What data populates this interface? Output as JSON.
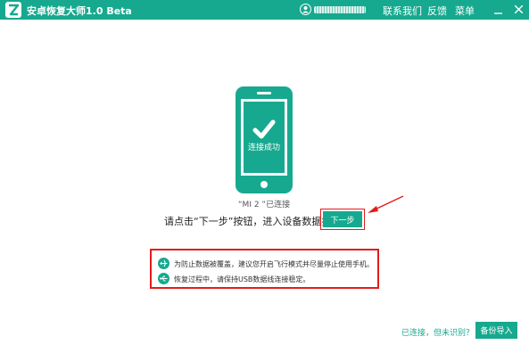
{
  "app": {
    "title": "安卓恢复大师1.0 Beta",
    "accent_color": "#17a98f",
    "highlight_color": "#e31b1b",
    "logo_icon": "app-logo-icon"
  },
  "header": {
    "user_icon": "user-avatar-icon",
    "menu": {
      "contact": "联系我们",
      "feedback": "反馈",
      "menu": "菜单"
    }
  },
  "main": {
    "phone_icon": "phone-connected-icon",
    "phone_status": "连接成功",
    "device_status": "“MI 2 ”已连接",
    "instruction": "请点击“下一步”按钮，进入设备数据扫描",
    "next_button": "下一步"
  },
  "tips": [
    {
      "icon": "airplane-icon",
      "text": "为防止数据被覆盖，建议您开启飞行模式并尽量停止使用手机。"
    },
    {
      "icon": "usb-icon",
      "text": "恢复过程中，请保持USB数据线连接稳定。"
    }
  ],
  "footer": {
    "status_link": "已连接，但未识别？",
    "backup_button": "备份导入"
  }
}
